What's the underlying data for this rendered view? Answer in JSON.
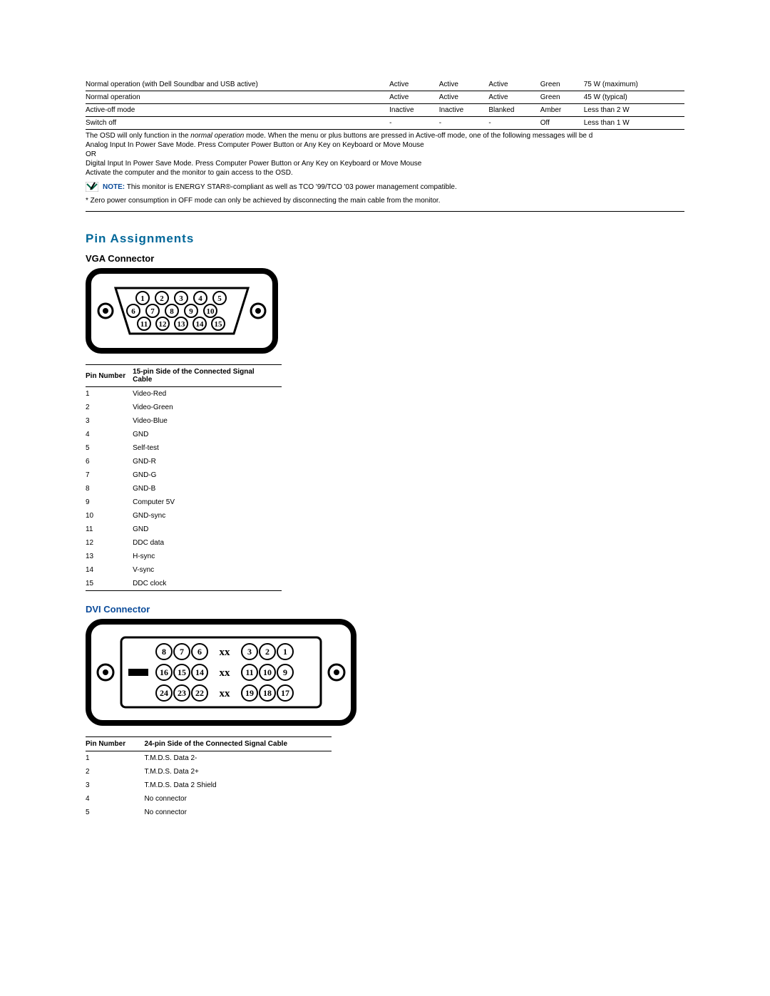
{
  "power_modes": {
    "rows": [
      {
        "mode": "Normal operation (with Dell Soundbar and USB active)",
        "hsync": "Active",
        "vsync": "Active",
        "video": "Active",
        "led": "Green",
        "power": "75 W (maximum)"
      },
      {
        "mode": "Normal operation",
        "hsync": "Active",
        "vsync": "Active",
        "video": "Active",
        "led": "Green",
        "power": "45 W (typical)"
      },
      {
        "mode": "Active-off mode",
        "hsync": "Inactive",
        "vsync": "Inactive",
        "video": "Blanked",
        "led": "Amber",
        "power": "Less than 2 W"
      },
      {
        "mode": "Switch off",
        "hsync": "-",
        "vsync": "-",
        "video": "-",
        "led": "Off",
        "power": "Less than 1 W"
      }
    ]
  },
  "osd": {
    "para1a": "The OSD will only function in the ",
    "para1_italic": "normal operation",
    "para1b": " mode. When the menu or plus buttons are pressed in Active-off mode, one of the following messages will be d",
    "line2": "Analog Input In Power Save Mode. Press Computer Power Button or Any Key on Keyboard or Move Mouse",
    "or": "OR",
    "line3": "Digital Input In Power Save Mode. Press Computer Power Button or Any Key on Keyboard or Move Mouse",
    "line4": "Activate the computer and the monitor to gain access to the OSD."
  },
  "note": {
    "label": "NOTE:",
    "text": " This monitor is ENERGY STAR®-compliant as well as TCO '99/TCO '03 power management compatible."
  },
  "zero_power": "* Zero power consumption in OFF mode can only be achieved by disconnecting the main cable from the monitor.",
  "headings": {
    "pin_assignments": "Pin Assignments",
    "vga": "VGA Connector",
    "dvi": "DVI Connector"
  },
  "vga_table": {
    "header_num": "Pin Number",
    "header_desc": "15-pin Side of the Connected Signal Cable",
    "rows": [
      {
        "n": "1",
        "d": "Video-Red"
      },
      {
        "n": "2",
        "d": "Video-Green"
      },
      {
        "n": "3",
        "d": "Video-Blue"
      },
      {
        "n": "4",
        "d": "GND"
      },
      {
        "n": "5",
        "d": "Self-test"
      },
      {
        "n": "6",
        "d": "GND-R"
      },
      {
        "n": "7",
        "d": "GND-G"
      },
      {
        "n": "8",
        "d": "GND-B"
      },
      {
        "n": "9",
        "d": "Computer 5V"
      },
      {
        "n": "10",
        "d": "GND-sync"
      },
      {
        "n": "11",
        "d": "GND"
      },
      {
        "n": "12",
        "d": "DDC data"
      },
      {
        "n": "13",
        "d": "H-sync"
      },
      {
        "n": "14",
        "d": "V-sync"
      },
      {
        "n": "15",
        "d": "DDC clock"
      }
    ]
  },
  "dvi_table": {
    "header_num": "Pin Number",
    "header_desc": "24-pin Side of the Connected Signal Cable",
    "rows": [
      {
        "n": "1",
        "d": "T.M.D.S. Data 2-"
      },
      {
        "n": "2",
        "d": "T.M.D.S. Data 2+"
      },
      {
        "n": "3",
        "d": "T.M.D.S. Data 2 Shield"
      },
      {
        "n": "4",
        "d": "No connector"
      },
      {
        "n": "5",
        "d": "No connector"
      }
    ]
  },
  "vga_diagram": {
    "pins_row1": [
      1,
      2,
      3,
      4,
      5
    ],
    "pins_row2": [
      6,
      7,
      8,
      9,
      10
    ],
    "pins_row3": [
      11,
      12,
      13,
      14,
      15
    ]
  },
  "dvi_diagram": {
    "row1": [
      "8",
      "7",
      "6",
      "xx",
      "3",
      "2",
      "1"
    ],
    "row2": [
      "16",
      "15",
      "14",
      "xx",
      "11",
      "10",
      "9"
    ],
    "row3": [
      "24",
      "23",
      "22",
      "xx",
      "19",
      "18",
      "17"
    ]
  }
}
